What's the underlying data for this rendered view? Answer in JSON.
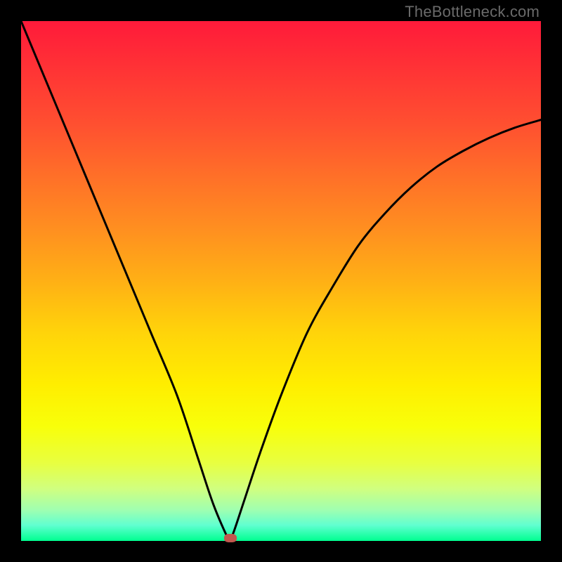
{
  "watermark": "TheBottleneck.com",
  "chart_data": {
    "type": "line",
    "title": "",
    "xlabel": "",
    "ylabel": "",
    "xlim": [
      0,
      100
    ],
    "ylim": [
      0,
      100
    ],
    "series": [
      {
        "name": "curve",
        "x": [
          0,
          5,
          10,
          15,
          20,
          25,
          30,
          34,
          37,
          39.8,
          40.3,
          41,
          43,
          46,
          50,
          55,
          60,
          65,
          70,
          75,
          80,
          85,
          90,
          95,
          100
        ],
        "y": [
          100,
          88,
          76,
          64,
          52,
          40,
          28,
          16,
          7,
          0.5,
          0.5,
          2,
          8,
          17,
          28,
          40,
          49,
          57,
          63,
          68,
          72,
          75,
          77.5,
          79.5,
          81
        ]
      }
    ],
    "marker": {
      "x": 40.3,
      "y": 0.5
    },
    "gradient": {
      "top": "#ff1a3a",
      "mid": "#ffee00",
      "bottom": "#00ff90"
    }
  }
}
